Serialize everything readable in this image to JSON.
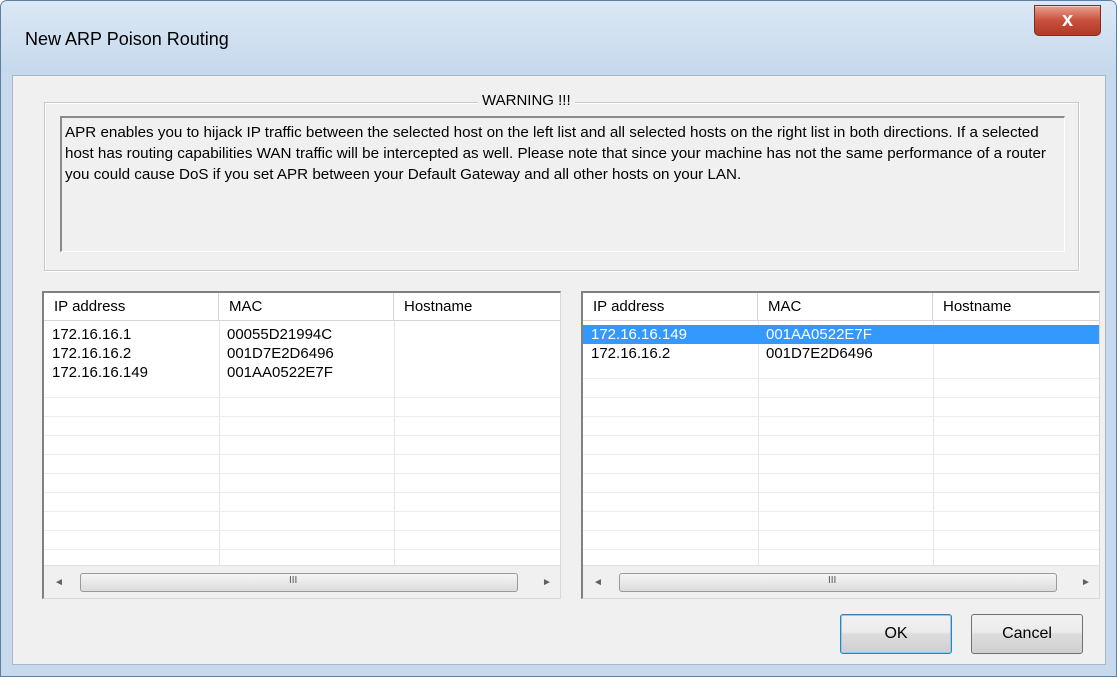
{
  "window": {
    "title": "New ARP Poison Routing",
    "close_label": "x"
  },
  "warning": {
    "title": "WARNING !!!",
    "text": "APR enables you to hijack IP traffic between the selected host on the left list and all selected hosts on the right list in both directions. If a selected host has routing capabilities WAN traffic will be intercepted as well. Please note that since your machine has not the same performance of a router you could cause DoS if you set APR between your Default Gateway and all other hosts on your LAN."
  },
  "left_list": {
    "columns": [
      "IP address",
      "MAC",
      "Hostname"
    ],
    "rows": [
      {
        "ip": "172.16.16.1",
        "mac": "00055D21994C",
        "hostname": "",
        "selected": false
      },
      {
        "ip": "172.16.16.2",
        "mac": "001D7E2D6496",
        "hostname": "",
        "selected": false
      },
      {
        "ip": "172.16.16.149",
        "mac": "001AA0522E7F",
        "hostname": "",
        "selected": false
      }
    ]
  },
  "right_list": {
    "columns": [
      "IP address",
      "MAC",
      "Hostname"
    ],
    "rows": [
      {
        "ip": "172.16.16.149",
        "mac": "001AA0522E7F",
        "hostname": "",
        "selected": true
      },
      {
        "ip": "172.16.16.2",
        "mac": "001D7E2D6496",
        "hostname": "",
        "selected": false
      }
    ]
  },
  "scrollbar": {
    "left_arrow": "◄",
    "right_arrow": "►",
    "grip": "III"
  },
  "buttons": {
    "ok": "OK",
    "cancel": "Cancel"
  },
  "colors": {
    "selection": "#3399ff",
    "titlebar": "#c7d9ec",
    "close": "#c9503b"
  }
}
